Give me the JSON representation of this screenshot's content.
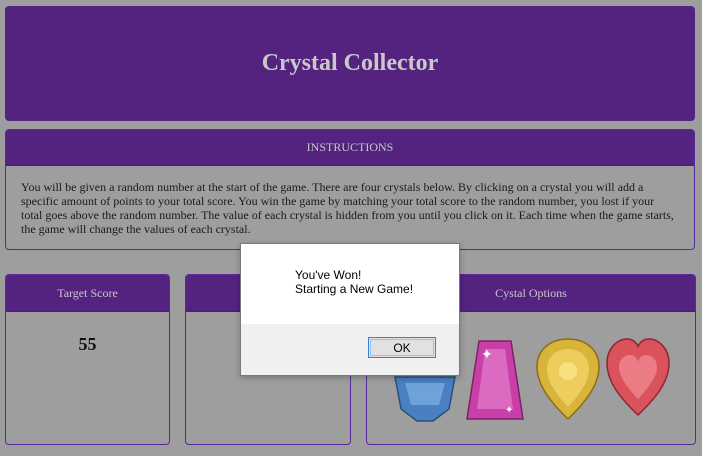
{
  "header": {
    "title": "Crystal Collector"
  },
  "instructions": {
    "heading": "INSTRUCTIONS",
    "text": "You will be given a random number at the start of the game. There are four crystals below. By clicking on a crystal you will add a specific amount of points to your total score. You win the game by matching your total score to the random number, you lost if your total goes above the random number. The value of each crystal is hidden from you until you click on it. Each time when the game starts, the game will change the values of each crystal."
  },
  "target": {
    "label": "Target Score",
    "value": "55"
  },
  "score": {
    "label": "",
    "value": ""
  },
  "options": {
    "label": "Cystal Options",
    "crystals": [
      {
        "name": "blue-crystal",
        "color": "#4a7fc0"
      },
      {
        "name": "pink-crystal",
        "color": "#c83fa8"
      },
      {
        "name": "yellow-crystal",
        "color": "#d9b43a"
      },
      {
        "name": "red-crystal",
        "color": "#d9525c"
      }
    ]
  },
  "dialog": {
    "line1": "You've Won!",
    "line2": "Starting a New Game!",
    "ok_label": "OK"
  }
}
